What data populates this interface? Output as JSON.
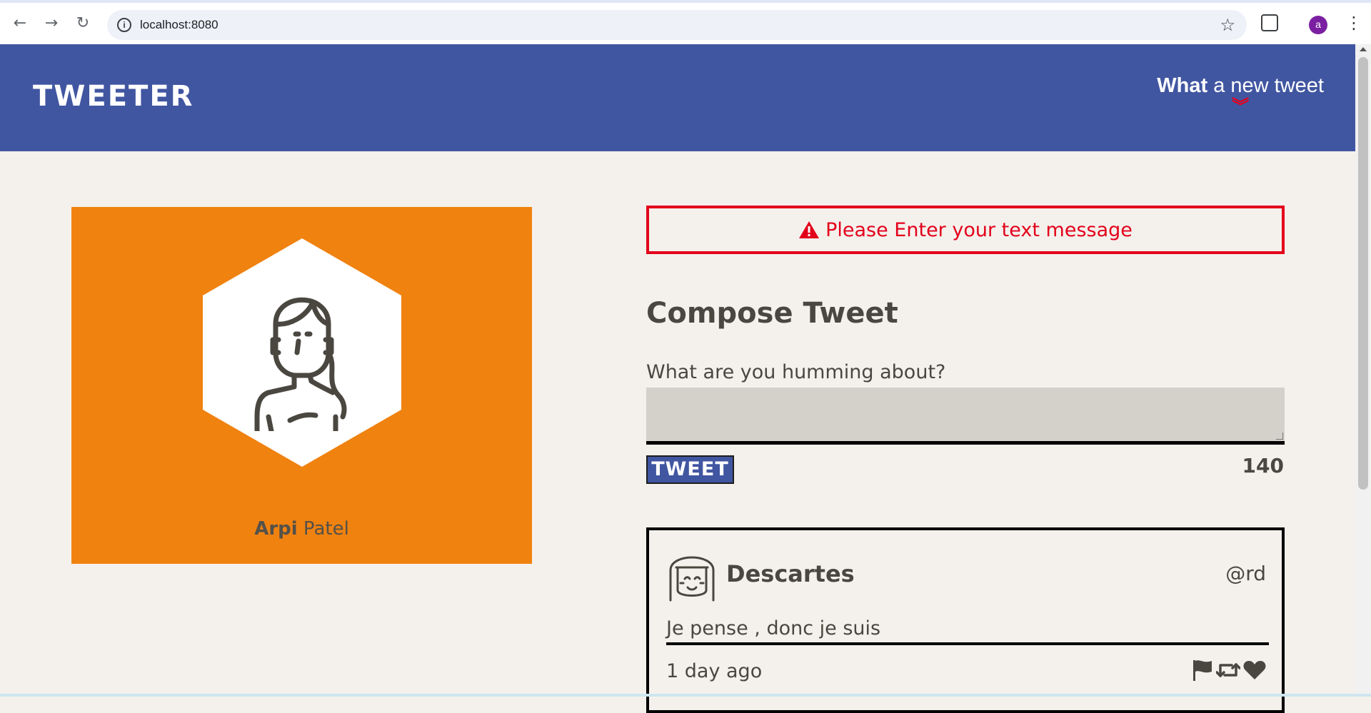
{
  "browser": {
    "url": "localhost:8080",
    "profile_initial": "a",
    "icons": [
      "back-arrow-icon",
      "forward-arrow-icon",
      "reload-icon",
      "info-icon",
      "star-icon",
      "extensions-icon",
      "kebab-menu-icon"
    ]
  },
  "header": {
    "brand": "TWEETER",
    "new_tweet_bold": "What",
    "new_tweet_rest": " a new tweet",
    "chevron_icon": "double-chevron-down-icon"
  },
  "profile": {
    "first_name": "Arpi",
    "last_name": " Patel"
  },
  "error": {
    "message": "Please Enter your text message",
    "icon": "warning-triangle-icon"
  },
  "compose": {
    "title": "Compose Tweet",
    "label": "What are you humming about?",
    "value": "",
    "button_label": "TWEET",
    "counter": "140"
  },
  "tweets": [
    {
      "author": "Descartes",
      "handle": "@rd",
      "text": "Je pense , donc je suis",
      "time": "1 day ago",
      "actions": [
        "flag-icon",
        "retweet-icon",
        "heart-icon"
      ]
    }
  ],
  "colors": {
    "header_bg": "#4156a1",
    "page_bg": "#f4f1ec",
    "profile_card_bg": "#f08210",
    "error": "#e3001b",
    "text": "#4a4740"
  }
}
